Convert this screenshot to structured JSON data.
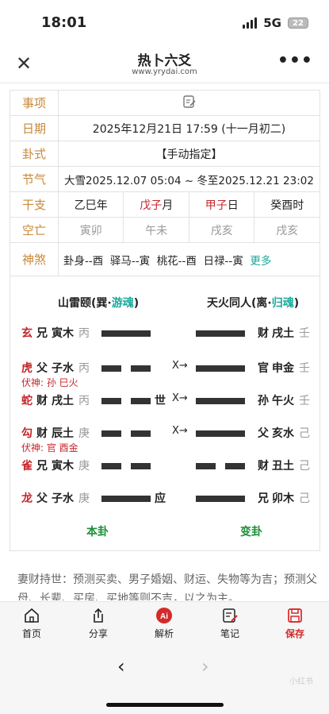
{
  "status": {
    "time": "18:01",
    "network": "5G",
    "battery": "22"
  },
  "nav": {
    "title": "热卜六爻",
    "subtitle": "www.yrydai.com",
    "more_label": "•••"
  },
  "info": {
    "shixiang_label": "事项",
    "riqi_label": "日期",
    "riqi_value": "2025年12月21日 17:59 (十一月初二)",
    "guashi_label": "卦式",
    "guashi_value": "【手动指定】",
    "jieqi_label": "节气",
    "jieqi_value": "大雪2025.12.07 05:04 ~ 冬至2025.12.21 23:02",
    "ganzhi_label": "干支",
    "ganzhi": [
      {
        "gz": "乙巳",
        "u": "年"
      },
      {
        "gz": "戊子",
        "u": "月"
      },
      {
        "gz": "甲子",
        "u": "日"
      },
      {
        "gz": "癸酉",
        "u": "时"
      }
    ],
    "kongwang_label": "空亡",
    "kongwang": [
      "寅卯",
      "午未",
      "戌亥",
      "戌亥"
    ],
    "shensha_label": "神煞",
    "shensha": [
      "卦身--酉",
      "驿马--寅",
      "桃花--酉",
      "日禄--寅"
    ],
    "shensha_more": "更多"
  },
  "gua": {
    "ben": {
      "name": "山雷颐(巽·",
      "tag": "游魂",
      "close": ")"
    },
    "bian": {
      "name": "天火同人(离·",
      "tag": "归魂",
      "close": ")"
    },
    "rows": [
      {
        "six": "玄",
        "rel": "兄",
        "gz": "寅木",
        "tg": "丙",
        "yang": true,
        "mark": "",
        "mv": "",
        "rrel": "财",
        "rgz": "戌土",
        "rtg": "壬",
        "ryang": true
      },
      {
        "six": "虎",
        "rel": "父",
        "gz": "子水",
        "tg": "丙",
        "yang": false,
        "mark": "",
        "mv": "X→",
        "rrel": "官",
        "rgz": "申金",
        "rtg": "壬",
        "ryang": true
      },
      {
        "six": "蛇",
        "rel": "财",
        "gz": "戌土",
        "tg": "丙",
        "yang": false,
        "mark": "世",
        "mv": "X→",
        "rrel": "孙",
        "rgz": "午火",
        "rtg": "壬",
        "ryang": true
      },
      {
        "six": "勾",
        "rel": "财",
        "gz": "辰土",
        "tg": "庚",
        "yang": false,
        "mark": "",
        "mv": "X→",
        "rrel": "父",
        "rgz": "亥水",
        "rtg": "己",
        "ryang": true
      },
      {
        "six": "雀",
        "rel": "兄",
        "gz": "寅木",
        "tg": "庚",
        "yang": false,
        "mark": "",
        "mv": "",
        "rrel": "财",
        "rgz": "丑土",
        "rtg": "己",
        "ryang": false
      },
      {
        "six": "龙",
        "rel": "父",
        "gz": "子水",
        "tg": "庚",
        "yang": true,
        "mark": "应",
        "mv": "",
        "rrel": "兄",
        "rgz": "卯木",
        "rtg": "己",
        "ryang": true
      }
    ],
    "fushen": [
      "伏神: 孙 巳火",
      "伏神: 官 酉金"
    ],
    "ben_label": "本卦",
    "bian_label": "变卦"
  },
  "description": "妻财持世：预测买卖、男子婚姻、财运、失物等为吉；预测父母、长辈、买房、买地等则不吉，以之为主。",
  "tabbar": [
    {
      "label": "首页",
      "icon": "home-icon"
    },
    {
      "label": "分享",
      "icon": "share-icon"
    },
    {
      "label": "解析",
      "icon": "ai-icon"
    },
    {
      "label": "笔记",
      "icon": "note-icon"
    },
    {
      "label": "保存",
      "icon": "save-icon"
    }
  ],
  "ai_badge": "Ai",
  "watermark": "小红书"
}
